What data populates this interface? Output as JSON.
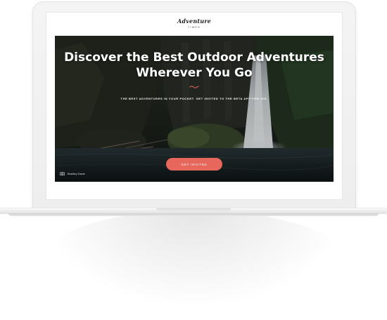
{
  "site": {
    "logo_text": "Adventure",
    "logo_subtext": "TIMES"
  },
  "hero": {
    "title_line1": "Discover the Best Outdoor Adventures",
    "title_line2": "Wherever You Go",
    "subtitle": "THE BEST ADVENTURES IN YOUR POCKET. GET INVITED TO THE BETA APP FOR IOS.",
    "cta_label": "GET INVITED",
    "photo_credit": "Bradley Davis"
  },
  "icons": {
    "divider": "wave-divider-icon",
    "credit": "camera-icon"
  },
  "colors": {
    "accent": "#e8675c",
    "hero_text": "#ffffff"
  }
}
